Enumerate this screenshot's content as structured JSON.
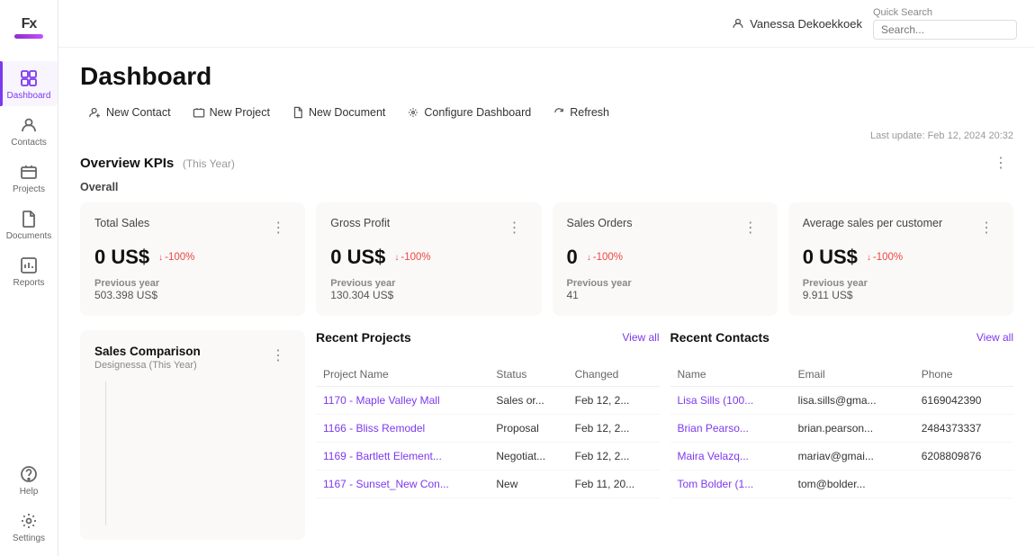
{
  "user": {
    "name": "Vanessa Dekoekkoek"
  },
  "quick_search": {
    "label": "Quick Search",
    "placeholder": "Search..."
  },
  "page": {
    "title": "Dashboard"
  },
  "toolbar": {
    "buttons": [
      {
        "id": "new-contact",
        "label": "New Contact",
        "icon": "contact"
      },
      {
        "id": "new-project",
        "label": "New Project",
        "icon": "project"
      },
      {
        "id": "new-document",
        "label": "New Document",
        "icon": "document"
      },
      {
        "id": "configure-dashboard",
        "label": "Configure Dashboard",
        "icon": "settings"
      },
      {
        "id": "refresh",
        "label": "Refresh",
        "icon": "refresh"
      }
    ]
  },
  "last_update": "Last update: Feb 12, 2024 20:32",
  "kpis": {
    "section_title": "Overview KPIs",
    "section_subtitle": "(This Year)",
    "overall_label": "Overall",
    "cards": [
      {
        "name": "Total Sales",
        "value": "0 US$",
        "change": "-100%",
        "prev_label": "Previous year",
        "prev_value": "503.398 US$"
      },
      {
        "name": "Gross Profit",
        "value": "0 US$",
        "change": "-100%",
        "prev_label": "Previous year",
        "prev_value": "130.304 US$"
      },
      {
        "name": "Sales Orders",
        "value": "0",
        "change": "-100%",
        "prev_label": "Previous year",
        "prev_value": "41"
      },
      {
        "name": "Average sales per customer",
        "value": "0 US$",
        "change": "-100%",
        "prev_label": "Previous year",
        "prev_value": "9.911 US$"
      }
    ]
  },
  "sales_comparison": {
    "title": "Sales Comparison",
    "subtitle": "Designessa (This Year)"
  },
  "recent_projects": {
    "title": "Recent Projects",
    "view_all": "View all",
    "columns": [
      "Project Name",
      "Status",
      "Changed"
    ],
    "rows": [
      {
        "name": "1170 - Maple Valley Mall",
        "status": "Sales or...",
        "changed": "Feb 12, 2..."
      },
      {
        "name": "1166 - Bliss Remodel",
        "status": "Proposal",
        "changed": "Feb 12, 2..."
      },
      {
        "name": "1169 - Bartlett Element...",
        "status": "Negotiat...",
        "changed": "Feb 12, 2..."
      },
      {
        "name": "1167 - Sunset_New Con...",
        "status": "New",
        "changed": "Feb 11, 20..."
      }
    ]
  },
  "recent_contacts": {
    "title": "Recent Contacts",
    "view_all": "View all",
    "columns": [
      "Name",
      "Email",
      "Phone"
    ],
    "rows": [
      {
        "name": "Lisa Sills (100...",
        "email": "lisa.sills@gma...",
        "phone": "6169042390"
      },
      {
        "name": "Brian Pearso...",
        "email": "brian.pearson...",
        "phone": "2484373337"
      },
      {
        "name": "Maira Velazq...",
        "email": "mariav@gmai...",
        "phone": "6208809876"
      },
      {
        "name": "Tom Bolder (1...",
        "email": "tom@bolder...",
        "phone": ""
      }
    ]
  },
  "sidebar": {
    "items": [
      {
        "id": "dashboard",
        "label": "Dashboard",
        "active": true
      },
      {
        "id": "contacts",
        "label": "Contacts",
        "active": false
      },
      {
        "id": "projects",
        "label": "Projects",
        "active": false
      },
      {
        "id": "documents",
        "label": "Documents",
        "active": false
      },
      {
        "id": "reports",
        "label": "Reports",
        "active": false
      }
    ],
    "bottom": [
      {
        "id": "help",
        "label": "Help",
        "active": false
      },
      {
        "id": "settings",
        "label": "Settings",
        "active": false
      }
    ]
  }
}
